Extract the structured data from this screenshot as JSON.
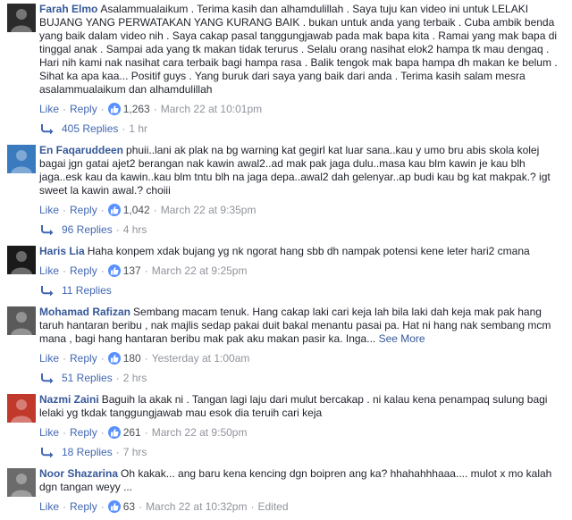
{
  "comments": [
    {
      "author": "Farah Elmo",
      "text": "Asalammualaikum . Terima kasih dan alhamdulillah . Saya tuju kan video ini untuk LELAKI BUJANG YANG PERWATAKAN YANG KURANG BAIK . bukan untuk anda yang terbaik . Cuba ambik benda yang baik dalam video nih . Saya cakap pasal tanggungjawab pada mak bapa kita . Ramai yang mak bapa di tinggal anak . Sampai ada yang tk makan tidak terurus . Selalu orang nasihat elok2 hampa tk mau dengaq . Hari nih kami nak nasihat cara terbaik bagi hampa rasa . Balik tengok mak bapa hampa dh makan ke belum . Sihat ka apa kaa... Positif guys . Yang buruk dari saya yang baik dari anda . Terima kasih salam mesra asalammualaikum dan alhamdulillah",
      "see_more": "",
      "like": "Like",
      "reply": "Reply",
      "reactions": "1,263",
      "time": "March 22 at 10:01pm",
      "edited": "",
      "replies": "405 Replies",
      "replies_time": "1 hr",
      "avatar_icon": "profile-photo-icon",
      "avatar_color": "#2b2b2b"
    },
    {
      "author": "En Faqaruddeen",
      "text": "phuii..lani ak plak na bg warning kat gegirl kat luar sana..kau y umo bru abis skola kolej bagai jgn gatai ajet2 berangan nak kawin awal2..ad mak pak jaga dulu..masa kau blm kawin je kau blh jaga..esk kau da kawin..kau blm tntu blh na jaga depa..awal2 dah gelenyar..ap budi kau bg kat makpak.? igt sweet la kawin awal.? choiii",
      "see_more": "",
      "like": "Like",
      "reply": "Reply",
      "reactions": "1,042",
      "time": "March 22 at 9:35pm",
      "edited": "",
      "replies": "96 Replies",
      "replies_time": "4 hrs",
      "avatar_icon": "profile-photo-icon",
      "avatar_color": "#3a7bbf"
    },
    {
      "author": "Haris Lia",
      "text": "Haha konpem xdak bujang yg nk ngorat hang sbb dh nampak potensi kene leter hari2 cmana",
      "see_more": "",
      "like": "Like",
      "reply": "Reply",
      "reactions": "137",
      "time": "March 22 at 9:25pm",
      "edited": "",
      "replies": "11 Replies",
      "replies_time": "",
      "avatar_icon": "profile-photo-icon",
      "avatar_color": "#1a1a1a"
    },
    {
      "author": "Mohamad Rafizan",
      "text": "Sembang macam tenuk. Hang cakap laki cari keja lah bila laki dah keja mak pak hang taruh hantaran beribu , nak majlis sedap pakai duit bakal menantu pasai pa. Hat ni hang nak sembang mcm mana , bagi hang hantaran beribu mak pak aku makan pasir ka. Inga...",
      "see_more": "See More",
      "like": "Like",
      "reply": "Reply",
      "reactions": "180",
      "time": "Yesterday at 1:00am",
      "edited": "",
      "replies": "51 Replies",
      "replies_time": "2 hrs",
      "avatar_icon": "profile-photo-icon",
      "avatar_color": "#5a5a5a"
    },
    {
      "author": "Nazmi Zaini",
      "text": "Baguih la akak ni . Tangan lagi laju dari mulut bercakap . ni kalau kena penampaq sulung bagi lelaki yg tkdak tanggungjawab mau esok dia teruih cari keja",
      "see_more": "",
      "like": "Like",
      "reply": "Reply",
      "reactions": "261",
      "time": "March 22 at 9:50pm",
      "edited": "",
      "replies": "18 Replies",
      "replies_time": "7 hrs",
      "avatar_icon": "profile-photo-icon",
      "avatar_color": "#c0392b"
    },
    {
      "author": "Noor Shazarina",
      "text": "Oh kakak... ang baru kena kencing dgn boipren ang ka? hhahahhhaaa.... mulot x mo kalah dgn tangan weyy ...",
      "see_more": "",
      "like": "Like",
      "reply": "Reply",
      "reactions": "63",
      "time": "March 22 at 10:32pm",
      "edited": "Edited",
      "replies": "",
      "replies_time": "",
      "avatar_icon": "profile-photo-icon",
      "avatar_color": "#6b6b6b"
    }
  ],
  "colors": {
    "link": "#4267b2",
    "author": "#365899",
    "meta": "#90949c",
    "like_badge": "#5890ff"
  }
}
